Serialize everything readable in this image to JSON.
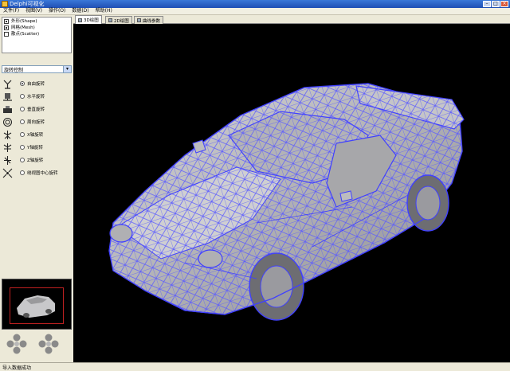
{
  "window": {
    "title": "Delphi可视化"
  },
  "menu": [
    {
      "label": "文件(F)"
    },
    {
      "label": "视图(V)"
    },
    {
      "label": "操作(O)"
    },
    {
      "label": "数据(D)"
    },
    {
      "label": "帮助(H)"
    }
  ],
  "layers": [
    {
      "label": "外形(Shape)",
      "checked": true
    },
    {
      "label": "网格(Mesh)",
      "checked": true
    },
    {
      "label": "散点(Scatter)",
      "checked": false
    }
  ],
  "control_combo": {
    "value": "旋转控制"
  },
  "modes": [
    {
      "label": "自由旋转",
      "icon": "free-rotate-icon",
      "selected": true
    },
    {
      "label": "水平旋转",
      "icon": "horizontal-rotate-icon",
      "selected": false
    },
    {
      "label": "垂直旋转",
      "icon": "vertical-rotate-icon",
      "selected": false
    },
    {
      "label": "周向旋转",
      "icon": "circular-rotate-icon",
      "selected": false
    },
    {
      "label": "X轴旋转",
      "icon": "x-axis-icon",
      "selected": false
    },
    {
      "label": "Y轴旋转",
      "icon": "y-axis-icon",
      "selected": false
    },
    {
      "label": "Z轴旋转",
      "icon": "z-axis-icon",
      "selected": false
    },
    {
      "label": "绕视图中心旋转",
      "icon": "center-rotate-icon",
      "selected": false
    }
  ],
  "tabs": [
    {
      "label": "3D绘图",
      "active": true
    },
    {
      "label": "2D绘图",
      "active": false
    },
    {
      "label": "曲线参数",
      "active": false
    }
  ],
  "status": {
    "text": "导入数据成功"
  },
  "colors": {
    "wire": "#5a5aff",
    "surface": "#b9b9bb",
    "viewport_bg": "#000000"
  }
}
